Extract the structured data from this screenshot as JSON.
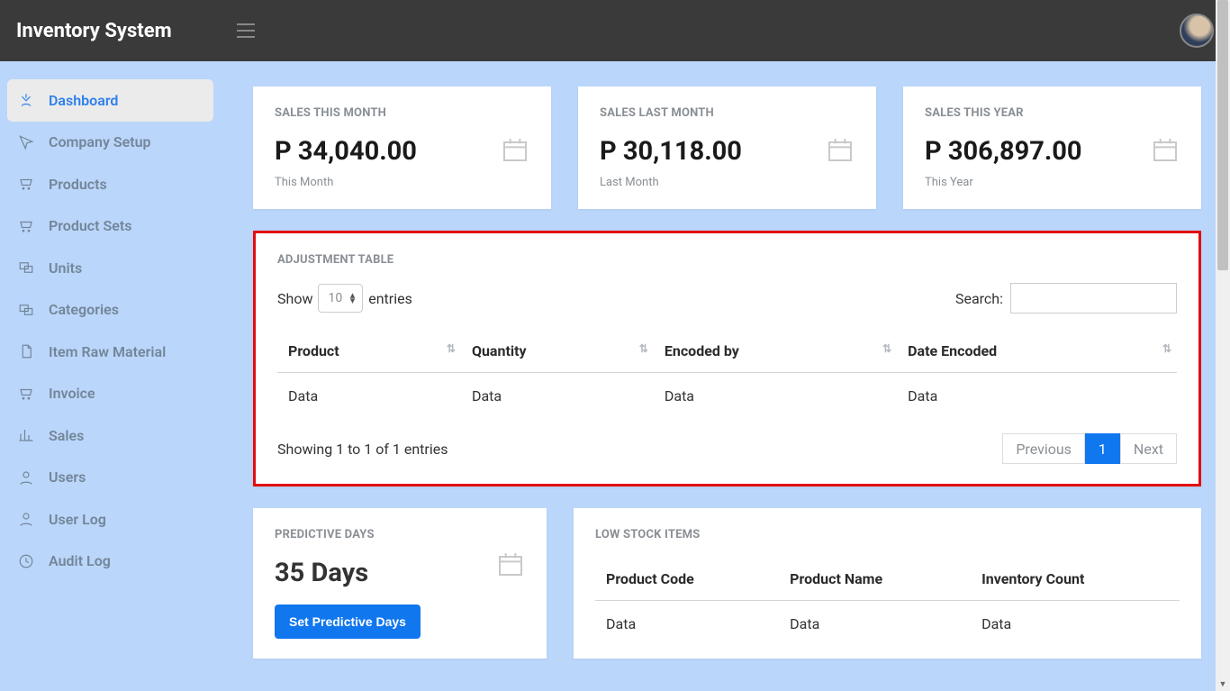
{
  "app_title": "Inventory System",
  "sidebar": {
    "items": [
      {
        "label": "Dashboard"
      },
      {
        "label": "Company Setup"
      },
      {
        "label": "Products"
      },
      {
        "label": "Product Sets"
      },
      {
        "label": "Units"
      },
      {
        "label": "Categories"
      },
      {
        "label": "Item Raw Material"
      },
      {
        "label": "Invoice"
      },
      {
        "label": "Sales"
      },
      {
        "label": "Users"
      },
      {
        "label": "User Log"
      },
      {
        "label": "Audit Log"
      }
    ]
  },
  "stats": [
    {
      "title": "SALES THIS MONTH",
      "value": "P 34,040.00",
      "sub": "This Month"
    },
    {
      "title": "SALES LAST MONTH",
      "value": "P 30,118.00",
      "sub": "Last Month"
    },
    {
      "title": "SALES THIS YEAR",
      "value": "P 306,897.00",
      "sub": "This Year"
    }
  ],
  "adjustment": {
    "title": "ADJUSTMENT TABLE",
    "show_label": "Show",
    "entries_label": "entries",
    "page_size": "10",
    "search_label": "Search:",
    "search_value": "",
    "columns": [
      "Product",
      "Quantity",
      "Encoded by",
      "Date Encoded"
    ],
    "rows": [
      [
        "Data",
        "Data",
        "Data",
        "Data"
      ]
    ],
    "info": "Showing 1 to 1 of 1 entries",
    "pager": {
      "prev": "Previous",
      "pages": [
        "1"
      ],
      "next": "Next"
    }
  },
  "predictive": {
    "title": "PREDICTIVE DAYS",
    "value": "35 Days",
    "button": "Set Predictive Days"
  },
  "low_stock": {
    "title": "LOW STOCK ITEMS",
    "columns": [
      "Product Code",
      "Product Name",
      "Inventory Count"
    ],
    "rows": [
      [
        "Data",
        "Data",
        "Data"
      ]
    ]
  }
}
